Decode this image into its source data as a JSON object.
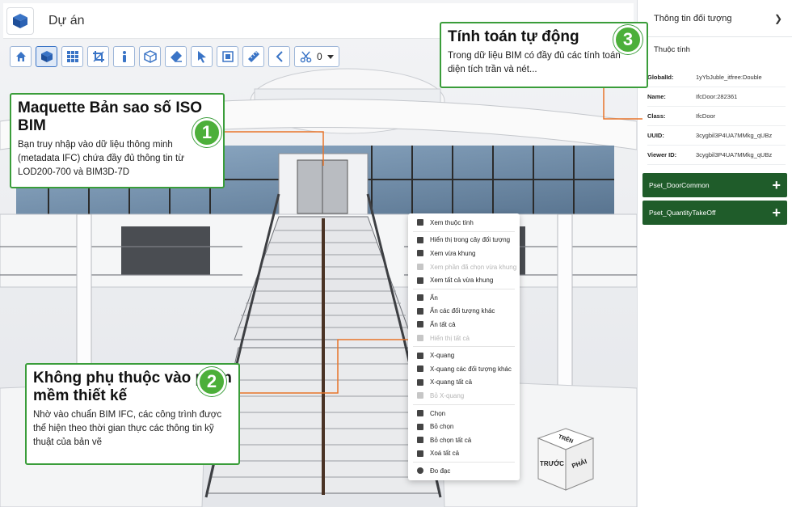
{
  "header": {
    "project_title": "Dự án"
  },
  "toolbar": {
    "clip_count": "0"
  },
  "callouts": {
    "one": {
      "number": "1",
      "title": "Maquette Bản sao số ISO BIM",
      "text": "Bạn truy nhập vào dữ liệu thông minh (metadata IFC) chứa đầy đủ thông tin từ LOD200-700 và BIM3D-7D"
    },
    "two": {
      "number": "2",
      "title": "Không phụ thuộc vào phần mềm thiết kế",
      "text": "Nhờ vào chuẩn BIM IFC, các công trình được thể hiện theo thời gian thực các thông tin kỹ thuật của bản vẽ"
    },
    "three": {
      "number": "3",
      "title": "Tính toán tự động",
      "text": "Trong dữ liệu BIM có đầy đủ các tính toán diện tích trần và nét..."
    }
  },
  "context_menu": {
    "view_properties": "Xem thuộc tính",
    "show_in_tree": "Hiển thị trong cây đối tượng",
    "zoom_fit": "Xem vừa khung",
    "zoom_fit_selected": "Xem phần đã chọn vừa khung",
    "zoom_fit_all": "Xem tất cả vừa khung",
    "hide": "Ẩn",
    "hide_others": "Ẩn các đối tượng khác",
    "hide_all": "Ẩn tất cả",
    "show_all": "Hiển thị tất cả",
    "xray": "X-quang",
    "xray_others": "X-quang các đối tượng khác",
    "xray_all": "X-quang tất cả",
    "xray_off": "Bỏ X-quang",
    "select": "Chọn",
    "deselect": "Bỏ chọn",
    "deselect_all": "Bỏ chọn tất cả",
    "clear_all": "Xoá tất cả",
    "measure": "Đo đạc"
  },
  "nav_cube": {
    "top": "TRÊN",
    "front": "TRƯỚC",
    "right": "PHẢI"
  },
  "panel": {
    "title": "Thông tin đối tượng",
    "properties_title": "Thuộc tính",
    "properties": [
      {
        "key": "GlobalId:",
        "value": "1yYbJuble_itfree:Double"
      },
      {
        "key": "Name:",
        "value": "IfcDoor:282361"
      },
      {
        "key": "Class:",
        "value": "IfcDoor"
      },
      {
        "key": "UUID:",
        "value": "3cygbil3P4UA7MMkg_qUBz"
      },
      {
        "key": "Viewer ID:",
        "value": "3cygbil3P4UA7MMkg_qUBz"
      }
    ],
    "psets": [
      {
        "label": "Pset_DoorCommon"
      },
      {
        "label": "Pset_QuantityTakeOff"
      }
    ]
  },
  "colors": {
    "accent_green": "#4caf3a",
    "pset_green": "#1f5c2a",
    "leader_orange": "#e8742a",
    "toolbar_blue": "#3a74c6"
  }
}
